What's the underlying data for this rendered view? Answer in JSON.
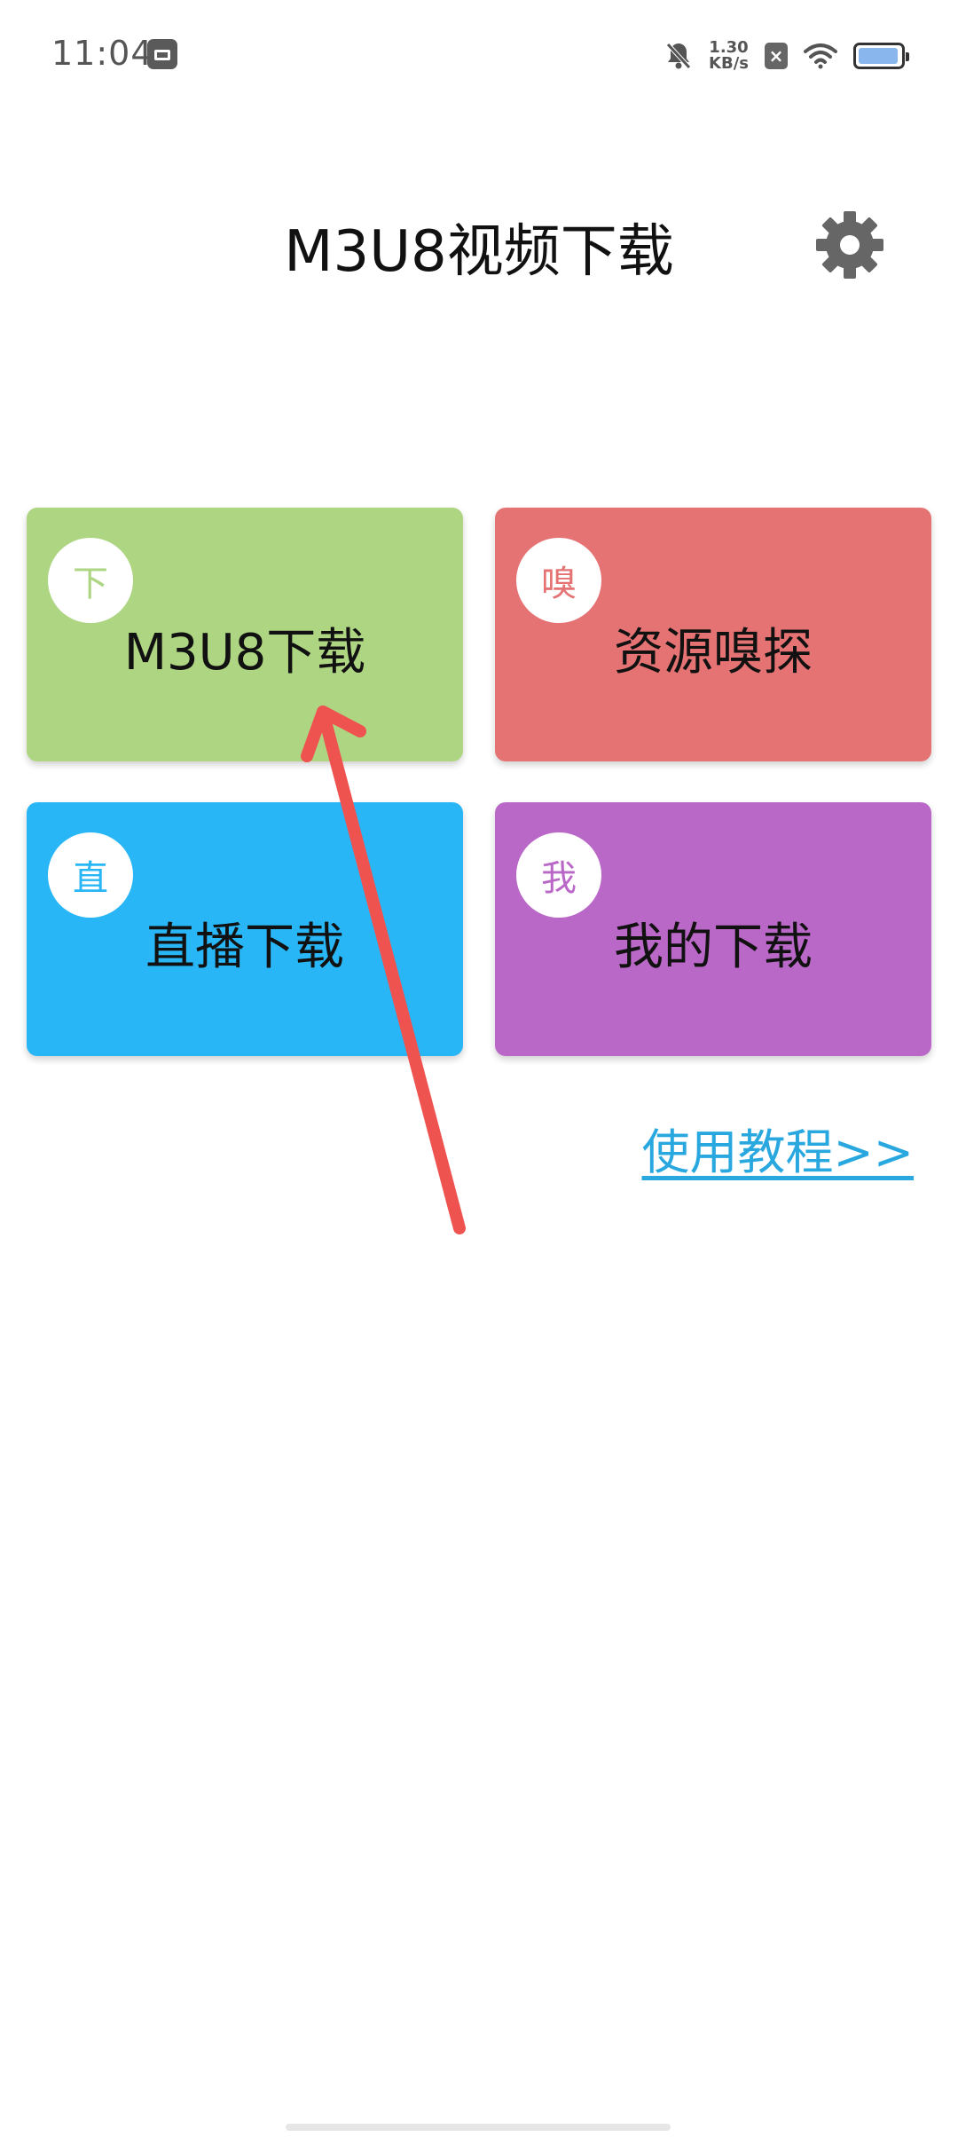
{
  "status_bar": {
    "time": "11:04",
    "netspeed_value": "1.30",
    "netspeed_unit": "KB/s",
    "battery_level": 0.95,
    "icons": [
      "app-notification-icon",
      "mute-icon",
      "close-box-icon",
      "wifi-icon",
      "battery-icon"
    ]
  },
  "header": {
    "title": "M3U8视频下载",
    "settings_icon": "gear-icon"
  },
  "cards": [
    {
      "badge": "下",
      "label": "M3U8下载",
      "color": "#aed581"
    },
    {
      "badge": "嗅",
      "label": "资源嗅探",
      "color": "#e57373"
    },
    {
      "badge": "直",
      "label": "直播下载",
      "color": "#29b6f6"
    },
    {
      "badge": "我",
      "label": "我的下载",
      "color": "#ba68c8"
    }
  ],
  "tutorial_link": "使用教程>>",
  "colors": {
    "link": "#29a8e0",
    "annotation_arrow": "#ef5350"
  }
}
